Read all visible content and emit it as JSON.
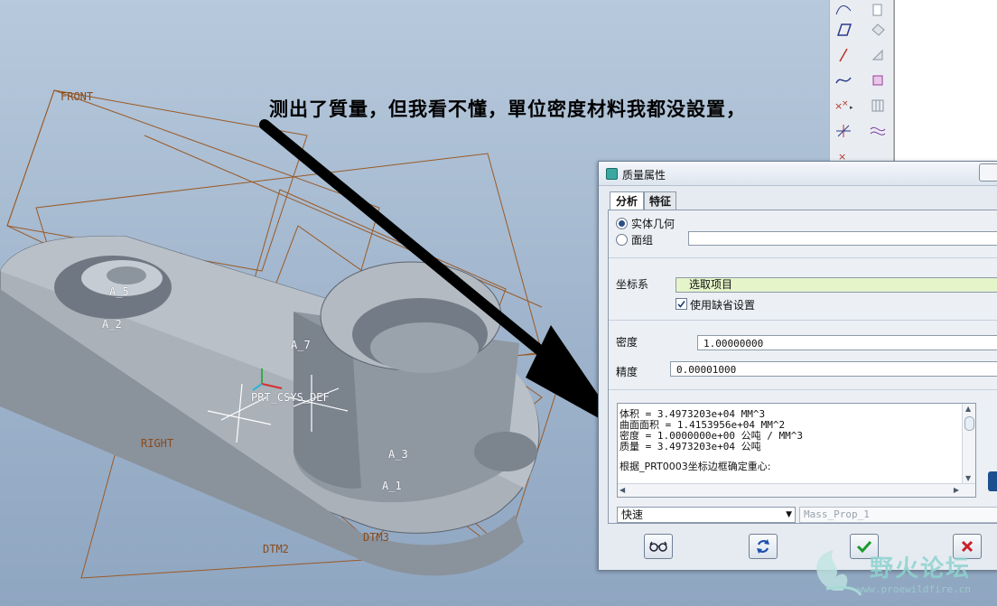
{
  "annotation": "测出了質量，但我看不懂，單位密度材料我都没設置，",
  "datums": {
    "front": "FRONT",
    "right": "RIGHT",
    "dtm2": "DTM2",
    "dtm3": "DTM3"
  },
  "features": {
    "a5": "A_5",
    "a2": "A_2",
    "a1": "A_1",
    "a3": "A_3",
    "a7": "A_7",
    "csys": "PRT_CSYS_DEF"
  },
  "dialog": {
    "title": "质量属性",
    "tabs": [
      "分析",
      "特征"
    ],
    "radio_solid": "实体几何",
    "radio_quilt": "面组",
    "quilt_value": "",
    "coord_label": "坐标系",
    "coord_value": "选取项目",
    "use_default_label": "使用缺省设置",
    "use_default_checked": true,
    "density_label": "密度",
    "density_value": "1.00000000",
    "precision_label": "精度",
    "precision_value": "0.00001000",
    "results": [
      "体积 =  3.4973203e+04  MM^3",
      "曲面面积 =  1.4153956e+04  MM^2",
      "密度 =  1.0000000e+00 公吨 / MM^3",
      "质量 =  3.4973203e+04 公吨",
      "根据_PRT0003坐标边框确定重心:"
    ],
    "mode_value": "快速",
    "name_placeholder": "Mass_Prop_1"
  },
  "watermark": {
    "text": "野火论坛",
    "url": "www.proewildfire.cn"
  },
  "colors": {
    "viewport_top": "#b7c9dc",
    "datum": "#8a4a1a",
    "dialog_bg": "#e6ebf1",
    "coord_field": "#e6f5c9"
  }
}
